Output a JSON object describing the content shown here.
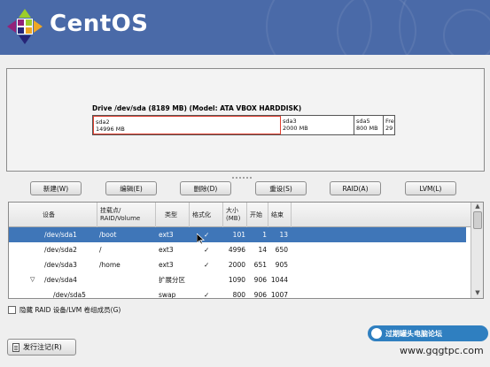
{
  "header": {
    "logo_text": "CentOS"
  },
  "drive": {
    "title": "Drive /dev/sda (8189 MB) (Model: ATA VBOX HARDDISK)",
    "segments": [
      {
        "name": "sda2",
        "size": "14996 MB"
      },
      {
        "name": "sda3",
        "size": "2000 MB"
      },
      {
        "name": "sda5",
        "size": "800 MB"
      },
      {
        "name": "Fre",
        "size": "29"
      }
    ]
  },
  "buttons": {
    "new": "新建(W)",
    "edit": "编辑(E)",
    "delete": "删除(D)",
    "reset": "重设(S)",
    "raid": "RAID(A)",
    "lvm": "LVM(L)"
  },
  "table": {
    "headers": {
      "device": "设备",
      "mount": "挂载点/\nRAID/Volume",
      "type": "类型",
      "format": "格式化",
      "size": "大小\n(MB)",
      "start": "开始",
      "end": "结束"
    },
    "rows": [
      {
        "device": "/dev/sda1",
        "mount": "/boot",
        "type": "ext3",
        "format": "✓",
        "size": "101",
        "start": "1",
        "end": "13",
        "selected": true
      },
      {
        "device": "/dev/sda2",
        "mount": "/",
        "type": "ext3",
        "format": "✓",
        "size": "4996",
        "start": "14",
        "end": "650"
      },
      {
        "device": "/dev/sda3",
        "mount": "/home",
        "type": "ext3",
        "format": "✓",
        "size": "2000",
        "start": "651",
        "end": "905"
      },
      {
        "device": "/dev/sda4",
        "mount": "",
        "type": "扩展分区",
        "format": "",
        "size": "1090",
        "start": "906",
        "end": "1044",
        "expander": "▽"
      },
      {
        "device": "/dev/sda5",
        "mount": "",
        "type": "swap",
        "format": "✓",
        "size": "800",
        "start": "906",
        "end": "1007"
      }
    ]
  },
  "hide_raid_label": "隐藏 RAID 设备/LVM 卷组成员(G)",
  "release_notes_label": "发行注记(R)",
  "watermark": {
    "text": "过期罐头电脑论坛",
    "url": "www.gqgtpc.com"
  },
  "colors": {
    "header_bg": "#4a6aa8",
    "selection": "#3f76b8"
  }
}
